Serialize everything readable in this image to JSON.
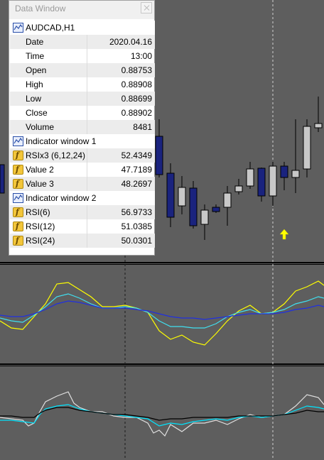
{
  "data_window": {
    "title": "Data Window",
    "symbol_header": "AUDCAD,H1",
    "fields": [
      {
        "label": "Date",
        "value": "2020.04.16"
      },
      {
        "label": "Time",
        "value": "13:00"
      },
      {
        "label": "Open",
        "value": "0.88753"
      },
      {
        "label": "High",
        "value": "0.88908"
      },
      {
        "label": "Low",
        "value": "0.88699"
      },
      {
        "label": "Close",
        "value": "0.88902"
      },
      {
        "label": "Volume",
        "value": "8481"
      }
    ],
    "indicator_window_1": {
      "header": "Indicator window 1",
      "rows": [
        {
          "label": "RSIx3 (6,12,24)",
          "value": "52.4349"
        },
        {
          "label": "Value 2",
          "value": "47.7189"
        },
        {
          "label": "Value 3",
          "value": "48.2697"
        }
      ]
    },
    "indicator_window_2": {
      "header": "Indicator window 2",
      "rows": [
        {
          "label": "RSI(6)",
          "value": "56.9733"
        },
        {
          "label": "RSI(12)",
          "value": "51.0385"
        },
        {
          "label": "RSI(24)",
          "value": "50.0301"
        }
      ]
    }
  },
  "colors": {
    "chart_bg": "#5e5e5e",
    "bear_candle": "#1a237e",
    "bull_candle": "#c8c8c8",
    "rsi_fast": "#ffff00",
    "rsi_mid": "#40e0f0",
    "rsi_slow": "#2030e0",
    "panel2_fast": "#e0e0e0",
    "panel2_mid": "#00e5ff",
    "panel2_slow": "#000000",
    "marker_arrow": "#ffff00"
  },
  "icons": {
    "chart_icon": "chart-window-icon",
    "function_icon": "function-icon",
    "close_icon": "close-icon",
    "marker": "up-arrow-icon"
  }
}
